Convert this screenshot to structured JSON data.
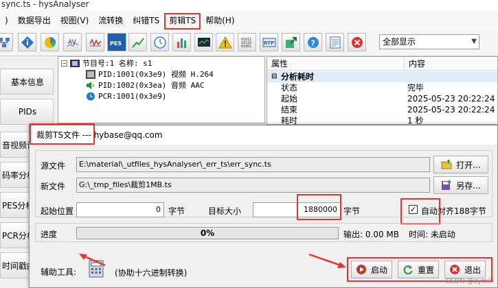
{
  "window": {
    "title": "sync.ts - hysAnalyser"
  },
  "menu": [
    {
      "label": ")"
    },
    {
      "label": "数据导出"
    },
    {
      "label": "视图(V)"
    },
    {
      "label": "流转换"
    },
    {
      "label": "纠错TS"
    },
    {
      "label": "剪辑TS"
    },
    {
      "label": "帮助(H)"
    }
  ],
  "toolbar": {
    "icons": [
      "network-icon",
      "info-icon",
      "pie-chart-icon",
      "av-icon",
      "wave-chart-icon",
      "pes-icon",
      "line-chart-icon",
      "clock-icon",
      "bar-chart-icon",
      "monitor-chart-icon",
      "warning-icon",
      "binary-icon",
      "rtp-icon",
      "export-icon",
      "help-icon",
      "notes-icon",
      "close-icon"
    ],
    "pes_label": "PES",
    "av_label": "AV",
    "rtp_label": "RTP",
    "display_select": "全部显示"
  },
  "left_nav": [
    "基本信息",
    "PIDs",
    "音视频详",
    "码率分析",
    "PES分析",
    "PCR分析",
    "时间戳曲"
  ],
  "tree": {
    "program": "节目号:1 名称: s1",
    "video": "PID:1001(0x3e9) 视频 H.264",
    "audio": "PID:1002(0x3ea) 音频 AAC",
    "pcr": "PCR:1001(0x3e9)"
  },
  "properties": {
    "col_attr": "属性",
    "col_value": "内容",
    "section": "分析耗时",
    "rows": [
      {
        "key": "状态",
        "value": "完毕"
      },
      {
        "key": "起始",
        "value": "2025-05-23  20:22:24"
      },
      {
        "key": "结束",
        "value": "2025-05-23  20:22:24"
      },
      {
        "key": "耗时",
        "value": "1 秒"
      }
    ]
  },
  "dialog": {
    "title": "裁剪TS文件 --- hybase@qq.com",
    "source_label": "源文件",
    "source_value": "E:\\material\\_utfiles_hysAnalyser\\_err_ts\\err_sync.ts",
    "open_button": "打开...",
    "new_label": "新文件",
    "new_value": "G:\\_tmp_files\\裁剪1MB.ts",
    "saveas_button": "另存...",
    "start_label": "起始位置",
    "start_value": "0",
    "byte_unit_1": "字节",
    "target_label": "目标大小",
    "target_value": "1880000",
    "byte_unit_2": "字节",
    "align_label": "自动对齐188字节",
    "align_checked": true,
    "progress_label": "进度",
    "progress_percent": 0,
    "progress_text": "0%",
    "output_text": "输出: 0.00 MB",
    "time_text": "时间: 未启动",
    "aux_label": "辅助工具:",
    "aux_hint": "(协助十六进制转换)",
    "start_button": "启动",
    "reset_button": "重置",
    "exit_button": "退出"
  },
  "watermark": "CSDN @zymill"
}
